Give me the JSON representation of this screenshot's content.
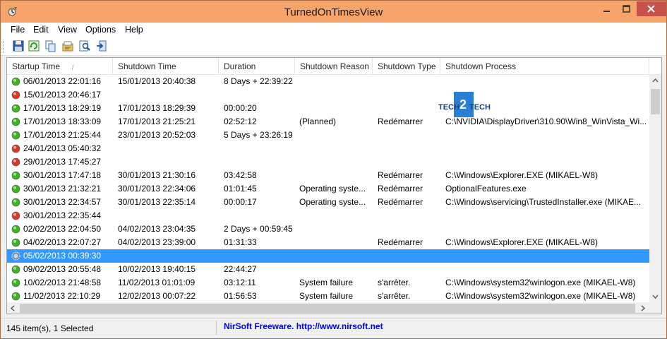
{
  "window": {
    "title": "TurnedOnTimesView",
    "title_color": "#f6a469",
    "close_color": "#c7504b"
  },
  "menu": [
    "File",
    "Edit",
    "View",
    "Options",
    "Help"
  ],
  "toolbar": {
    "icons": [
      "save-icon",
      "refresh-icon",
      "copy-icon",
      "properties-icon",
      "find-icon",
      "exit-icon"
    ]
  },
  "columns": [
    "Startup Time",
    "Shutdown Time",
    "Duration",
    "Shutdown Reason",
    "Shutdown Type",
    "Shutdown Process"
  ],
  "sort_indicator": "/",
  "rows": [
    {
      "status": "green",
      "startup": "06/01/2013 22:01:16",
      "shutdown": "15/01/2013 20:40:38",
      "duration": "8 Days + 22:39:22",
      "reason": "",
      "type": "",
      "process": ""
    },
    {
      "status": "red",
      "startup": "15/01/2013 20:46:17",
      "shutdown": "",
      "duration": "",
      "reason": "",
      "type": "",
      "process": ""
    },
    {
      "status": "green",
      "startup": "17/01/2013 18:29:19",
      "shutdown": "17/01/2013 18:29:39",
      "duration": "00:00:20",
      "reason": "",
      "type": "",
      "process": ""
    },
    {
      "status": "green",
      "startup": "17/01/2013 18:33:09",
      "shutdown": "17/01/2013 21:25:21",
      "duration": "02:52:12",
      "reason": " (Planned)",
      "type": "Redémarrer",
      "process": "C:\\NVIDIA\\DisplayDriver\\310.90\\Win8_WinVista_Wi..."
    },
    {
      "status": "green",
      "startup": "17/01/2013 21:25:44",
      "shutdown": "23/01/2013 20:52:03",
      "duration": "5 Days + 23:26:19",
      "reason": "",
      "type": "",
      "process": ""
    },
    {
      "status": "red",
      "startup": "24/01/2013 05:40:32",
      "shutdown": "",
      "duration": "",
      "reason": "",
      "type": "",
      "process": ""
    },
    {
      "status": "red",
      "startup": "29/01/2013 17:45:27",
      "shutdown": "",
      "duration": "",
      "reason": "",
      "type": "",
      "process": ""
    },
    {
      "status": "green",
      "startup": "30/01/2013 17:47:18",
      "shutdown": "30/01/2013 21:30:16",
      "duration": "03:42:58",
      "reason": "",
      "type": "Redémarrer",
      "process": "C:\\Windows\\Explorer.EXE (MIKAEL-W8)"
    },
    {
      "status": "green",
      "startup": "30/01/2013 21:32:21",
      "shutdown": "30/01/2013 22:34:06",
      "duration": "01:01:45",
      "reason": "Operating syste...",
      "type": "Redémarrer",
      "process": "OptionalFeatures.exe"
    },
    {
      "status": "green",
      "startup": "30/01/2013 22:34:57",
      "shutdown": "30/01/2013 22:35:14",
      "duration": "00:00:17",
      "reason": "Operating syste...",
      "type": "Redémarrer",
      "process": "C:\\Windows\\servicing\\TrustedInstaller.exe (MIKAE..."
    },
    {
      "status": "red",
      "startup": "30/01/2013 22:35:44",
      "shutdown": "",
      "duration": "",
      "reason": "",
      "type": "",
      "process": ""
    },
    {
      "status": "green",
      "startup": "02/02/2013 22:04:50",
      "shutdown": "04/02/2013 23:04:35",
      "duration": "2 Days + 00:59:45",
      "reason": "",
      "type": "",
      "process": ""
    },
    {
      "status": "green",
      "startup": "04/02/2013 22:07:27",
      "shutdown": "04/02/2013 23:39:00",
      "duration": "01:31:33",
      "reason": "",
      "type": "Redémarrer",
      "process": "C:\\Windows\\Explorer.EXE (MIKAEL-W8)"
    },
    {
      "status": "running",
      "startup": "05/02/2013 00:39:30",
      "shutdown": "",
      "duration": "",
      "reason": "",
      "type": "",
      "process": "",
      "selected": true
    },
    {
      "status": "green",
      "startup": "09/02/2013 20:55:48",
      "shutdown": "10/02/2013 19:40:15",
      "duration": "22:44:27",
      "reason": "",
      "type": "",
      "process": ""
    },
    {
      "status": "green",
      "startup": "10/02/2013 21:48:58",
      "shutdown": "11/02/2013 01:01:09",
      "duration": "03:12:11",
      "reason": "System failure",
      "type": "s'arrêter.",
      "process": "C:\\Windows\\system32\\winlogon.exe (MIKAEL-W8)"
    },
    {
      "status": "green",
      "startup": "11/02/2013 22:10:29",
      "shutdown": "12/02/2013 00:07:22",
      "duration": "01:56:53",
      "reason": "System failure",
      "type": "s'arrêter.",
      "process": "C:\\Windows\\system32\\winlogon.exe (MIKAEL-W8)"
    }
  ],
  "watermark": {
    "line1": "TECH",
    "badge": "2",
    "line2": "TECH"
  },
  "status": {
    "count": "145 item(s), 1 Selected",
    "link": "NirSoft Freeware.  http://www.nirsoft.net"
  },
  "colors": {
    "selection": "#3399ff",
    "status_green": "#3cb521",
    "status_red": "#d8382a",
    "link": "#0000ee"
  }
}
